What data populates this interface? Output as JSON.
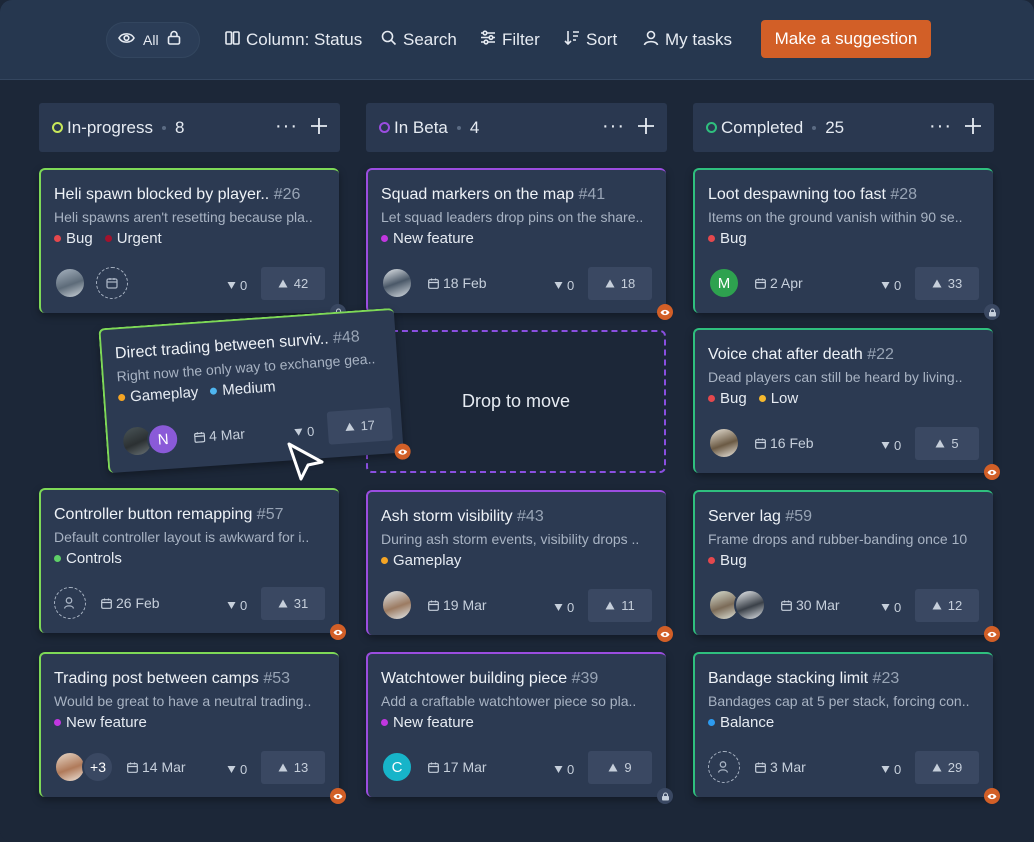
{
  "toolbar": {
    "visibility_label": "All",
    "column_label": "Column: Status",
    "search_label": "Search",
    "filter_label": "Filter",
    "sort_label": "Sort",
    "my_tasks_label": "My tasks",
    "suggest_label": "Make a suggestion"
  },
  "colors": {
    "accent_orange": "#d25f27",
    "in_progress": "#c8e85a",
    "in_beta": "#9b4de0",
    "completed": "#2fbf7e"
  },
  "columns": [
    {
      "title": "In-progress",
      "count": "8"
    },
    {
      "title": "In Beta",
      "count": "4"
    },
    {
      "title": "Completed",
      "count": "25"
    }
  ],
  "drop_zone_label": "Drop to move",
  "cards": {
    "c1": {
      "title": "Heli spawn blocked by player..",
      "num": "#26",
      "desc": "Heli spawns aren't resetting because pla..",
      "tag1": "Bug",
      "tag2": "Urgent",
      "down": "0",
      "up": "42"
    },
    "c2": {
      "title": "Controller button remapping",
      "num": "#57",
      "desc": "Default controller layout is awkward for i..",
      "tag1": "Controls",
      "date": "26 Feb",
      "down": "0",
      "up": "31"
    },
    "c3": {
      "title": "Trading post between camps",
      "num": "#53",
      "desc": "Would be great to have a neutral trading..",
      "tag1": "New feature",
      "extra": "+3",
      "date": "14 Mar",
      "down": "0",
      "up": "13"
    },
    "c4": {
      "title": "Squad markers on the map",
      "num": "#41",
      "desc": "Let squad leaders drop pins on the share..",
      "tag1": "New feature",
      "date": "18 Feb",
      "down": "0",
      "up": "18"
    },
    "c5": {
      "title": "Ash storm visibility",
      "num": "#43",
      "desc": "During ash storm events, visibility drops ..",
      "tag1": "Gameplay",
      "date": "19 Mar",
      "down": "0",
      "up": "11"
    },
    "c6": {
      "title": "Watchtower building piece",
      "num": "#39",
      "desc": "Add a craftable watchtower piece so pla..",
      "tag1": "New feature",
      "avatar": "C",
      "date": "17 Mar",
      "down": "0",
      "up": "9"
    },
    "c7": {
      "title": "Loot despawning too fast",
      "num": "#28",
      "desc": "Items on the ground vanish within 90 se..",
      "tag1": "Bug",
      "avatar": "M",
      "date": "2 Apr",
      "down": "0",
      "up": "33"
    },
    "c8": {
      "title": "Voice chat after death",
      "num": "#22",
      "desc": "Dead players can still be heard by living..",
      "tag1": "Bug",
      "tag2": "Low",
      "date": "16 Feb",
      "down": "0",
      "up": "5"
    },
    "c9": {
      "title": "Server lag",
      "num": "#59",
      "desc": "Frame drops and rubber-banding once 10",
      "tag1": "Bug",
      "date": "30 Mar",
      "down": "0",
      "up": "12"
    },
    "c10": {
      "title": "Bandage stacking limit",
      "num": "#23",
      "desc": "Bandages cap at 5 per stack, forcing con..",
      "tag1": "Balance",
      "date": "3 Mar",
      "down": "0",
      "up": "29"
    },
    "drag": {
      "title": "Direct trading between surviv..",
      "num": "#48",
      "desc": "Right now the only way to exchange gea..",
      "tag1": "Gameplay",
      "tag2": "Medium",
      "avatar": "N",
      "date": "4 Mar",
      "down": "0",
      "up": "17"
    }
  }
}
